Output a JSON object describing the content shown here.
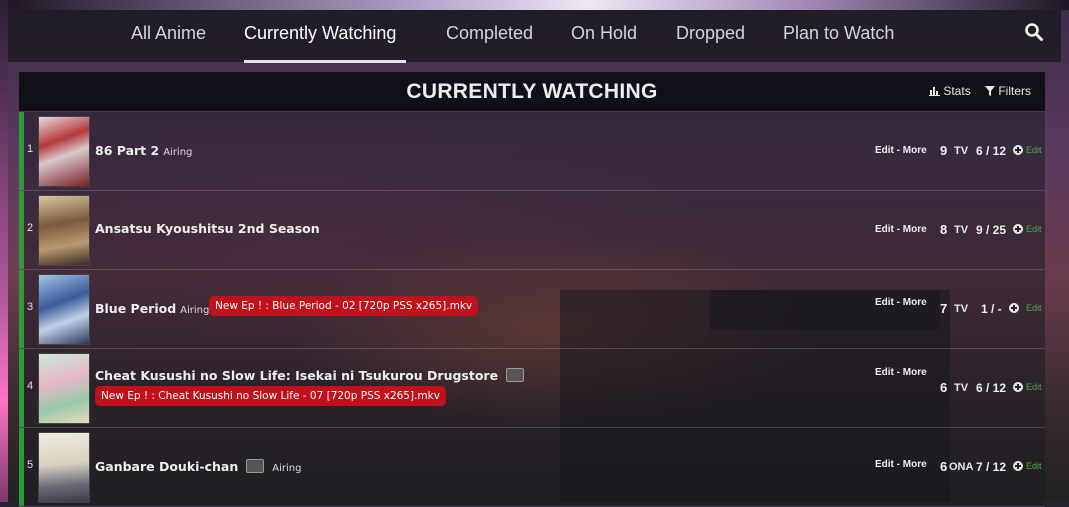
{
  "nav": {
    "tabs": [
      "All Anime",
      "Currently Watching",
      "Completed",
      "On Hold",
      "Dropped",
      "Plan to Watch"
    ],
    "active_tab": "Currently Watching"
  },
  "header": {
    "title": "CURRENTLY WATCHING",
    "stats_label": "Stats",
    "filters_label": "Filters"
  },
  "colors": {
    "status_bar": "#2e9a3c",
    "badge": "#c1121b",
    "edit_link": "#46b04e"
  },
  "rows": [
    {
      "num": "1",
      "title": "86 Part 2",
      "status": "Airing",
      "badge": "",
      "edit_more": "Edit - More",
      "score": "9",
      "type": "TV",
      "progress": "6 / 12",
      "edit": "Edit"
    },
    {
      "num": "2",
      "title": "Ansatsu Kyoushitsu 2nd Season",
      "status": "",
      "badge": "",
      "edit_more": "Edit - More",
      "score": "8",
      "type": "TV",
      "progress": "9 / 25",
      "edit": "Edit"
    },
    {
      "num": "3",
      "title": "Blue Period",
      "status": "Airing",
      "badge": "New Ep ! : Blue Period - 02 [720p PSS x265].mkv",
      "edit_more": "Edit - More",
      "score": "7",
      "type": "TV",
      "progress": "1 / -",
      "edit": "Edit"
    },
    {
      "num": "4",
      "title": "Cheat Kusushi no Slow Life: Isekai ni Tsukurou Drugstore",
      "status": "",
      "badge": "New Ep ! : Cheat Kusushi no Slow Life - 07 [720p PSS x265].mkv",
      "edit_more": "Edit - More",
      "score": "6",
      "type": "TV",
      "progress": "6 / 12",
      "edit": "Edit"
    },
    {
      "num": "5",
      "title": "Ganbare Douki-chan",
      "status": "Airing",
      "badge": "",
      "edit_more": "Edit - More",
      "score": "6",
      "type": "ONA",
      "progress": "7 / 12",
      "edit": "Edit"
    }
  ]
}
